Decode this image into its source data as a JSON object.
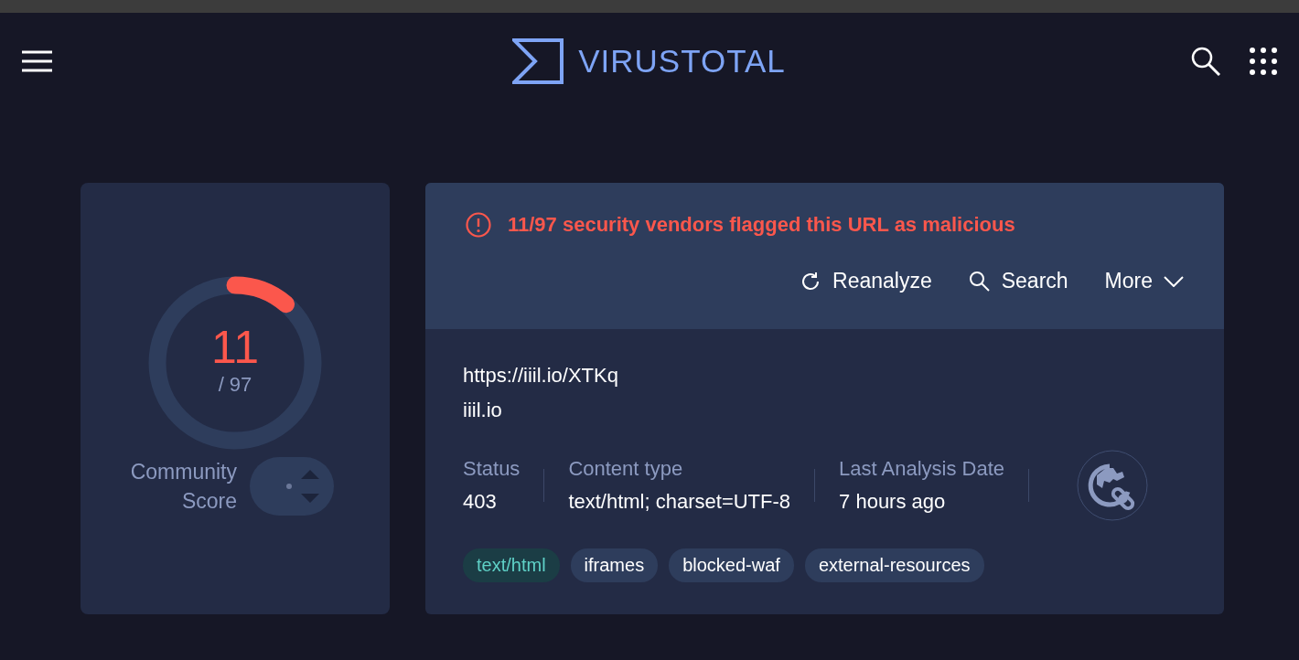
{
  "header": {
    "logo_text": "VIRUSTOTAL"
  },
  "score": {
    "detections": "11",
    "total": "/ 97",
    "community_label": "Community Score"
  },
  "summary": {
    "alert": "11/97 security vendors flagged this URL as malicious",
    "actions": [
      {
        "kind": "reanalyze",
        "label": "Reanalyze"
      },
      {
        "kind": "search",
        "label": "Search"
      },
      {
        "kind": "more",
        "label": "More"
      }
    ],
    "url": "https://iiil.io/XTKq",
    "domain": "iiil.io",
    "facts": [
      {
        "label": "Status",
        "value": "403"
      },
      {
        "label": "Content type",
        "value": "text/html; charset=UTF-8"
      },
      {
        "label": "Last Analysis Date",
        "value": "7 hours ago"
      }
    ],
    "tags": [
      {
        "kind": "type",
        "label": "text/html"
      },
      {
        "kind": "tag",
        "label": "iframes"
      },
      {
        "kind": "tag",
        "label": "blocked-waf"
      },
      {
        "kind": "tag",
        "label": "external-resources"
      }
    ]
  }
}
